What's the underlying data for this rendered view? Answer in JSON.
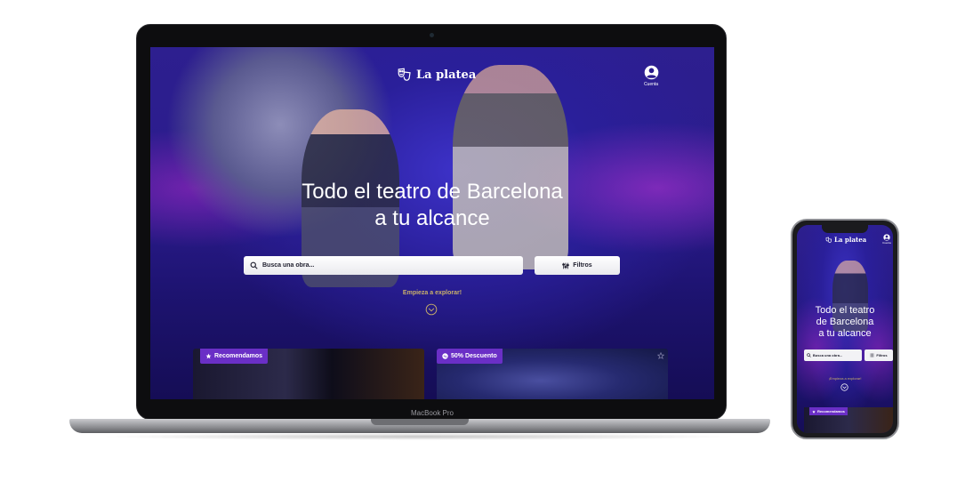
{
  "site": {
    "brand": "La platea",
    "account_label": "Cuenta",
    "hero_title_line1": "Todo el teatro de Barcelona",
    "hero_title_line2": "a tu alcance",
    "search_placeholder": "Busca una obra...",
    "filters_label": "Filtros",
    "explore_label": "Empieza a explorar!",
    "cards": [
      {
        "badge": "Recomendamos",
        "badge_icon": "star-icon"
      },
      {
        "badge": "50% Descuento",
        "badge_icon": "discount-icon"
      }
    ]
  },
  "device": {
    "laptop_label": "MacBook Pro"
  },
  "phone": {
    "brand": "La platea",
    "account_label": "Cuenta",
    "title_line1": "Todo el teatro",
    "title_line2": "de Barcelona",
    "title_line3": "a tu alcance",
    "search_placeholder": "Busca una obra...",
    "filters_label": "Filtros",
    "explore_label": "¡Empieza a explorar!",
    "card_badge": "Recomendamos"
  },
  "colors": {
    "accent": "#6a2fc6",
    "hero_bg": "#2a1b8c",
    "explore_gold": "#c9b06a"
  }
}
